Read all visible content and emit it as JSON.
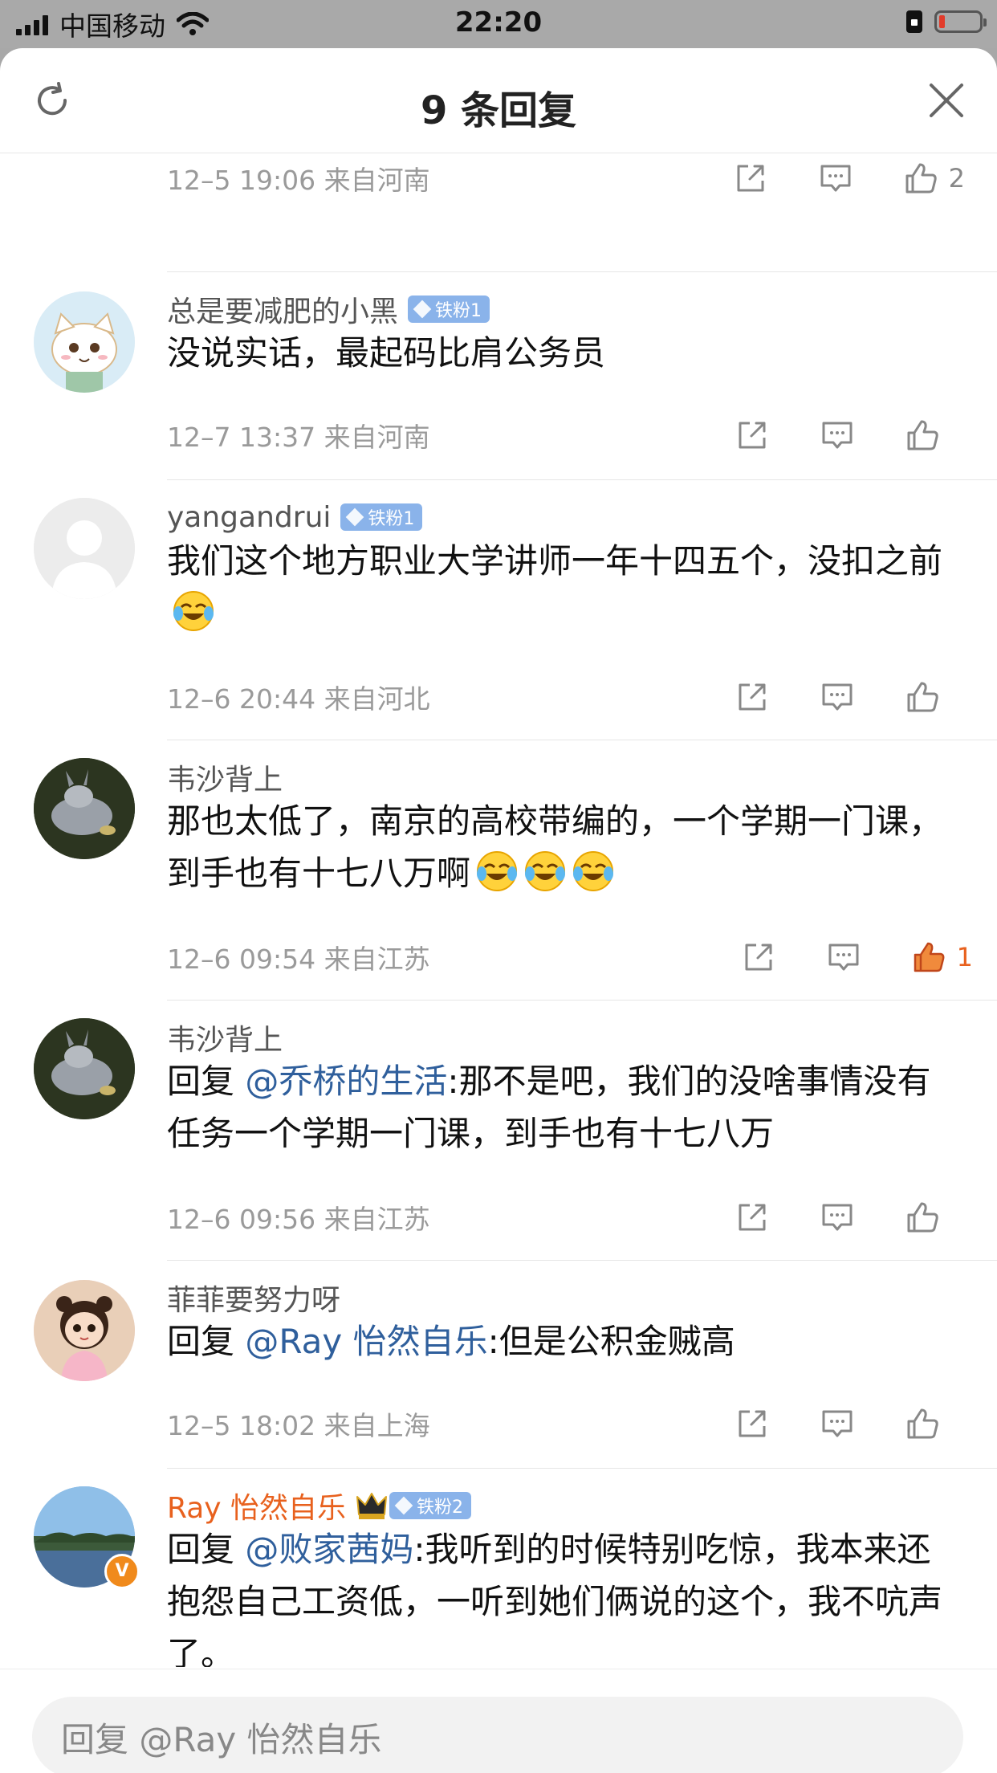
{
  "status_bar": {
    "carrier": "中国移动",
    "time": "22:20"
  },
  "header": {
    "title": "9 条回复"
  },
  "first_meta": {
    "meta": "12–5 19:06  来自河南",
    "likes": "2"
  },
  "comments": [
    {
      "username": "总是要减肥的小黑",
      "badge": "铁粉1",
      "text": "没说实话，最起码比肩公务员",
      "meta": "12–7 13:37  来自河南",
      "likes": ""
    },
    {
      "username": "yangandrui",
      "badge": "铁粉1",
      "text": "我们这个地方职业大学讲师一年十四五个，没扣之前",
      "meta": "12–6 20:44  来自河北",
      "likes": ""
    },
    {
      "username": "韦沙背上",
      "text": "那也太低了，南京的高校带编的，一个学期一门课，到手也有十七八万啊",
      "meta": "12–6 09:54  来自江苏",
      "likes": "1"
    },
    {
      "username": "韦沙背上",
      "reply_prefix": "回复 ",
      "mention": "@乔桥的生活",
      "text": ":那不是吧，我们的没啥事情没有任务一个学期一门课，到手也有十七八万",
      "meta": "12–6 09:56  来自江苏",
      "likes": ""
    },
    {
      "username": "菲菲要努力呀",
      "reply_prefix": "回复 ",
      "mention": "@Ray 怡然自乐",
      "text": ":但是公积金贼高",
      "meta": "12–5 18:02  来自上海",
      "likes": ""
    },
    {
      "username": "Ray 怡然自乐",
      "badge": "铁粉2",
      "verified_mark": "V",
      "reply_prefix": "回复 ",
      "mention": "@败家茜妈",
      "text": ":我听到的时候特别吃惊，我本来还抱怨自己工资低，一听到她们俩说的这个，我不吭声了。"
    }
  ],
  "footer": {
    "placeholder": "回复 @Ray 怡然自乐"
  },
  "colors": {
    "accent": "#e8611e",
    "mention": "#2f5f9c",
    "badge": "#8ab3ea"
  }
}
